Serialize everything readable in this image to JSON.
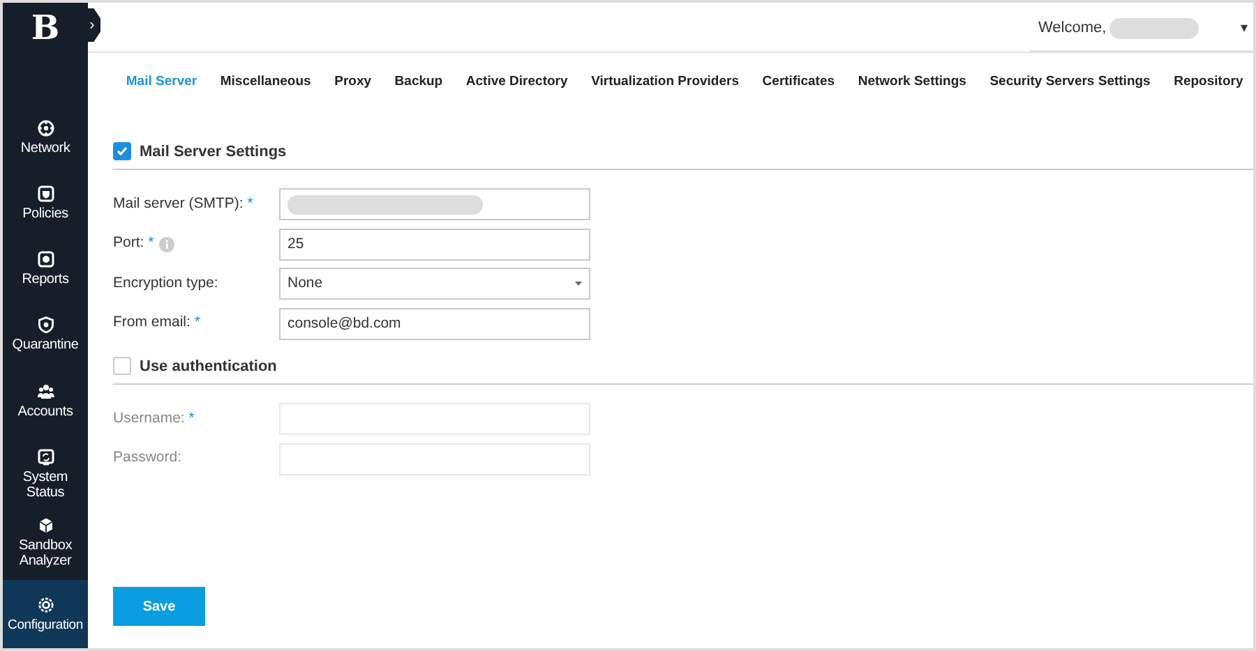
{
  "sidebar": {
    "logo": "B",
    "expand_glyph": "›",
    "items": [
      {
        "label": "Network",
        "selected": false
      },
      {
        "label": "Policies",
        "selected": false
      },
      {
        "label": "Reports",
        "selected": false
      },
      {
        "label": "Quarantine",
        "selected": false
      },
      {
        "label": "Accounts",
        "selected": false
      },
      {
        "label": "System Status",
        "selected": false
      },
      {
        "label": "Sandbox Analyzer",
        "selected": false
      },
      {
        "label": "Configuration",
        "selected": true
      }
    ]
  },
  "header": {
    "welcome": "Welcome,",
    "caret": "▾"
  },
  "tabs": [
    {
      "label": "Mail Server",
      "selected": true
    },
    {
      "label": "Miscellaneous",
      "selected": false
    },
    {
      "label": "Proxy",
      "selected": false
    },
    {
      "label": "Backup",
      "selected": false
    },
    {
      "label": "Active Directory",
      "selected": false
    },
    {
      "label": "Virtualization Providers",
      "selected": false
    },
    {
      "label": "Certificates",
      "selected": false
    },
    {
      "label": "Network Settings",
      "selected": false
    },
    {
      "label": "Security Servers Settings",
      "selected": false
    },
    {
      "label": "Repository",
      "selected": false
    }
  ],
  "sections": [
    {
      "title": "Mail Server Settings",
      "checked": true,
      "fields": [
        {
          "kind": "text",
          "label": "Mail server (SMTP):",
          "required_mark": "*",
          "redacted": true,
          "disabled": false
        },
        {
          "kind": "text",
          "label": "Port:",
          "required_mark": "*",
          "info": true,
          "value": "25",
          "disabled": false
        },
        {
          "kind": "select",
          "label": "Encryption type:",
          "value": "None",
          "disabled": false
        },
        {
          "kind": "text",
          "label": "From email:",
          "required_mark": "*",
          "value": "console@bd.com",
          "disabled": false
        }
      ]
    },
    {
      "title": "Use authentication",
      "checked": false,
      "fields": [
        {
          "kind": "text",
          "label": "Username:",
          "required_mark": "*",
          "disabled": true
        },
        {
          "kind": "password",
          "label": "Password:",
          "disabled": true
        }
      ]
    }
  ],
  "save_button": "Save"
}
